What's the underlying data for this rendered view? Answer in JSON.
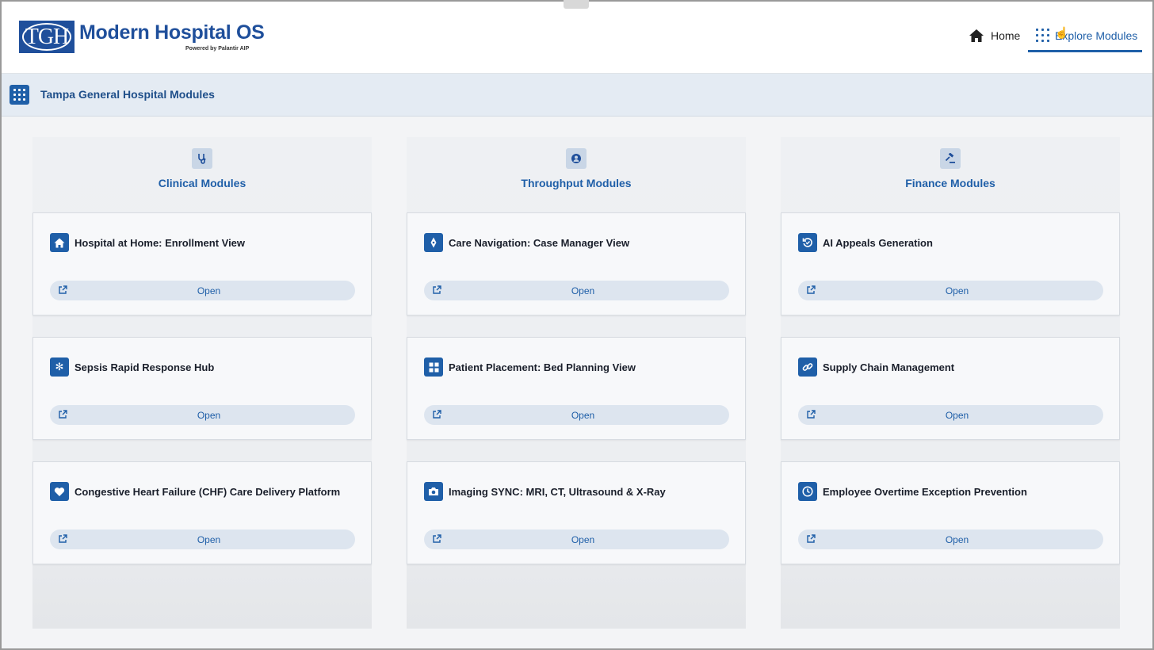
{
  "header": {
    "logo_text": "TGH",
    "app_title": "Modern Hospital OS",
    "powered_by": "Powered by Palantir AIP",
    "nav": {
      "home_label": "Home",
      "explore_label": "Explore Modules"
    }
  },
  "subheader": {
    "title": "Tampa General Hospital Modules"
  },
  "columns": [
    {
      "title": "Clinical Modules",
      "icon": "stethoscope-icon",
      "modules": [
        {
          "title": "Hospital at Home: Enrollment View",
          "icon": "house-icon",
          "button": "Open"
        },
        {
          "title": "Sepsis Rapid Response Hub",
          "icon": "snowflake-icon",
          "button": "Open"
        },
        {
          "title": "Congestive Heart Failure (CHF) Care Delivery Platform",
          "icon": "heart-icon",
          "button": "Open"
        }
      ]
    },
    {
      "title": "Throughput Modules",
      "icon": "person-badge-icon",
      "modules": [
        {
          "title": "Care Navigation: Case Manager View",
          "icon": "compass-icon",
          "button": "Open"
        },
        {
          "title": "Patient Placement: Bed Planning View",
          "icon": "grid-icon",
          "button": "Open"
        },
        {
          "title": "Imaging SYNC: MRI, CT, Ultrasound & X-Ray",
          "icon": "camera-icon",
          "button": "Open"
        }
      ]
    },
    {
      "title": "Finance Modules",
      "icon": "gavel-icon",
      "modules": [
        {
          "title": "AI Appeals Generation",
          "icon": "refresh-icon",
          "button": "Open"
        },
        {
          "title": "Supply Chain Management",
          "icon": "link-icon",
          "button": "Open"
        },
        {
          "title": "Employee Overtime Exception Prevention",
          "icon": "clock-icon",
          "button": "Open"
        }
      ]
    }
  ],
  "colors": {
    "brand_blue": "#1f4f9b",
    "accent_blue": "#1f5fa8",
    "subheader_bg": "#e4ebf3",
    "button_bg": "#dde5ef"
  }
}
